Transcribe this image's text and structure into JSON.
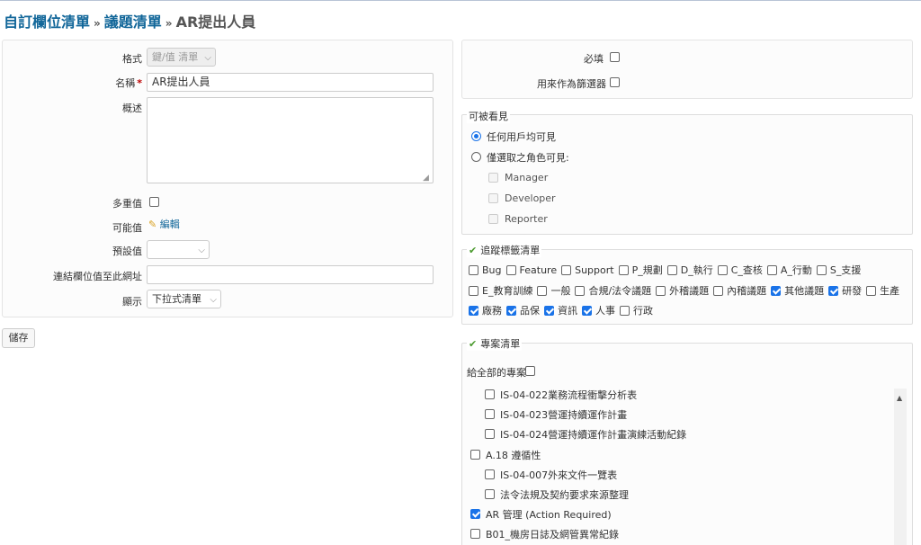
{
  "breadcrumb": {
    "items": [
      "自訂欄位清單",
      "議題清單"
    ],
    "current": "AR提出人員",
    "separator": "»"
  },
  "form": {
    "format_label": "格式",
    "format_value": "鍵/值 清單",
    "name_label": "名稱",
    "required_mark": "*",
    "name_value": "AR提出人員",
    "description_label": "概述",
    "multiple_label": "多重值",
    "possible_values_label": "可能值",
    "edit_link": "編輯",
    "default_label": "預設值",
    "default_value": "",
    "url_label": "連結欄位值至此網址",
    "url_value": "",
    "display_label": "顯示",
    "display_value": "下拉式清單",
    "save_label": "儲存"
  },
  "options": {
    "required_label": "必填",
    "filter_label": "用來作為篩選器"
  },
  "visibility": {
    "legend": "可被看見",
    "all_users": "任何用戶均可見",
    "roles_only": "僅選取之角色可見:",
    "roles": [
      "Manager",
      "Developer",
      "Reporter"
    ]
  },
  "trackers": {
    "legend": "追蹤標籤清單",
    "rows": [
      [
        {
          "label": "Bug",
          "checked": false
        },
        {
          "label": "Feature",
          "checked": false
        },
        {
          "label": "Support",
          "checked": false
        },
        {
          "label": "P_規劃",
          "checked": false
        },
        {
          "label": "D_執行",
          "checked": false
        },
        {
          "label": "C_查核",
          "checked": false
        },
        {
          "label": "A_行動",
          "checked": false
        },
        {
          "label": "S_支援",
          "checked": false
        }
      ],
      [
        {
          "label": "E_教育訓練",
          "checked": false
        },
        {
          "label": "一般",
          "checked": false
        },
        {
          "label": "合規/法令議題",
          "checked": false
        },
        {
          "label": "外稽議題",
          "checked": false
        },
        {
          "label": "內稽議題",
          "checked": false
        },
        {
          "label": "其他議題",
          "checked": true
        },
        {
          "label": "研發",
          "checked": true
        },
        {
          "label": "生產",
          "checked": false
        }
      ],
      [
        {
          "label": "廠務",
          "checked": true
        },
        {
          "label": "品保",
          "checked": true
        },
        {
          "label": "資訊",
          "checked": true
        },
        {
          "label": "人事",
          "checked": true
        },
        {
          "label": "行政",
          "checked": false
        }
      ]
    ]
  },
  "projects": {
    "legend": "專案清單",
    "all_projects": "給全部的專案",
    "items": [
      {
        "label": "IS-04-022業務流程衝擊分析表",
        "checked": false,
        "indent": true
      },
      {
        "label": "IS-04-023營運持續運作計畫",
        "checked": false,
        "indent": true
      },
      {
        "label": "IS-04-024營運持續運作計畫演練活動紀錄",
        "checked": false,
        "indent": true
      },
      {
        "label": "A.18 遵循性",
        "checked": false,
        "indent": false
      },
      {
        "label": "IS-04-007外來文件一覽表",
        "checked": false,
        "indent": true
      },
      {
        "label": "法令法規及契約要求來源整理",
        "checked": false,
        "indent": true
      },
      {
        "label": "AR 管理 (Action Required)",
        "checked": true,
        "indent": false
      },
      {
        "label": "B01_機房日誌及網管異常紀錄",
        "checked": false,
        "indent": false
      }
    ]
  },
  "colors": {
    "link": "#116699",
    "checkbox_checked": "#1a73e8",
    "check_icon": "#4a9a2e"
  }
}
